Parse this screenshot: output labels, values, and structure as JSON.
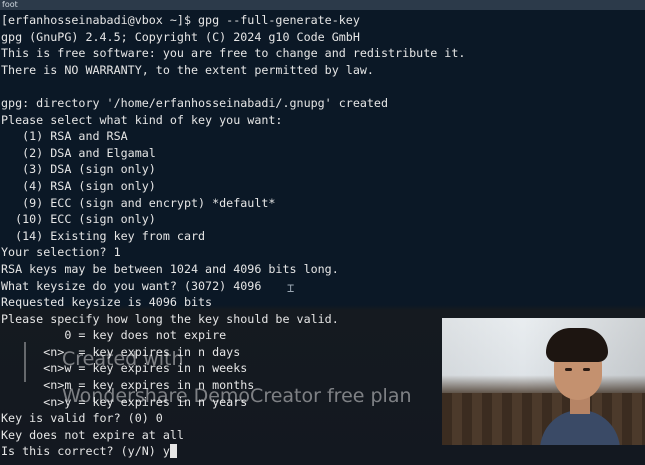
{
  "window": {
    "title": "foot"
  },
  "terminal": {
    "lines": [
      "[erfanhosseinabadi@vbox ~]$ gpg --full-generate-key",
      "gpg (GnuPG) 2.4.5; Copyright (C) 2024 g10 Code GmbH",
      "This is free software: you are free to change and redistribute it.",
      "There is NO WARRANTY, to the extent permitted by law.",
      "",
      "gpg: directory '/home/erfanhosseinabadi/.gnupg' created",
      "Please select what kind of key you want:",
      "   (1) RSA and RSA",
      "   (2) DSA and Elgamal",
      "   (3) DSA (sign only)",
      "   (4) RSA (sign only)",
      "   (9) ECC (sign and encrypt) *default*",
      "  (10) ECC (sign only)",
      "  (14) Existing key from card",
      "Your selection? 1",
      "RSA keys may be between 1024 and 4096 bits long.",
      "What keysize do you want? (3072) 4096",
      "Requested keysize is 4096 bits",
      "Please specify how long the key should be valid.",
      "         0 = key does not expire",
      "      <n>  = key expires in n days",
      "      <n>w = key expires in n weeks",
      "      <n>m = key expires in n months",
      "      <n>y = key expires in n years",
      "Key is valid for? (0) 0",
      "Key does not expire at all",
      "Is this correct? (y/N) y"
    ]
  },
  "watermark": {
    "line1": "Created with",
    "line2": "Wondershare DemoCreator free plan"
  },
  "colors": {
    "background": "#0b1826",
    "foreground": "#e6e6e6",
    "titlebar": "#2c3a4a"
  },
  "icons": {
    "text_cursor": "i-beam-cursor-icon"
  }
}
